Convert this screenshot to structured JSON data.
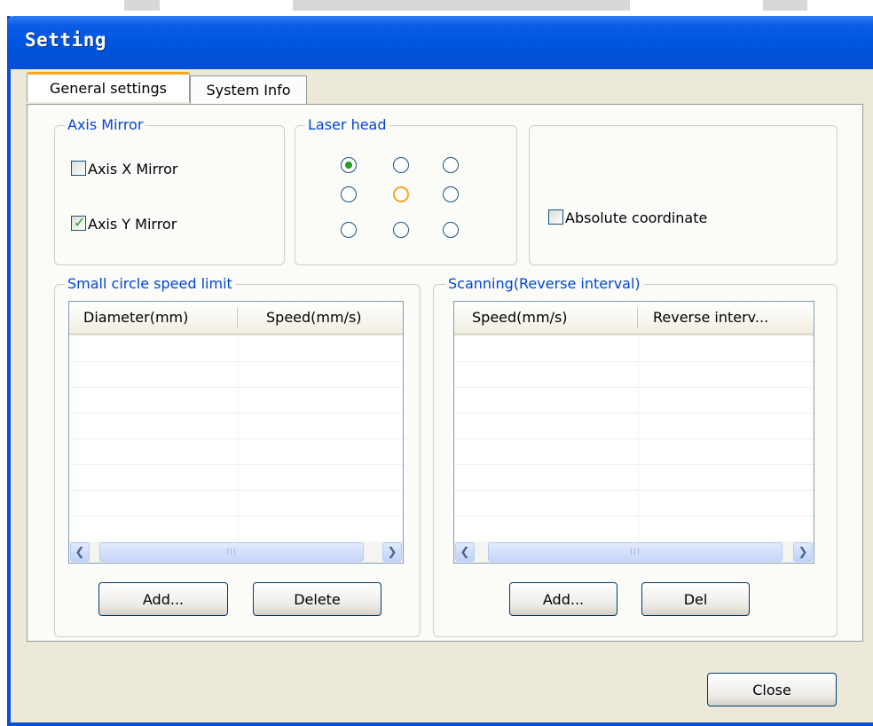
{
  "window": {
    "title": "Setting"
  },
  "tabs": [
    {
      "label": "General settings",
      "active": true
    },
    {
      "label": "System Info",
      "active": false
    }
  ],
  "axis_mirror": {
    "legend": "Axis Mirror",
    "x_mirror": {
      "label": "Axis X Mirror",
      "checked": false
    },
    "y_mirror": {
      "label": "Axis Y Mirror",
      "checked": true
    }
  },
  "laser_head": {
    "legend": "Laser head",
    "grid": [
      [
        "selected",
        "normal",
        "normal"
      ],
      [
        "normal",
        "hover",
        "normal"
      ],
      [
        "normal",
        "normal",
        "normal"
      ]
    ]
  },
  "coordinate": {
    "label": "Absolute coordinate",
    "checked": false
  },
  "small_circle": {
    "legend": "Small circle speed limit",
    "columns": [
      "Diameter(mm)",
      "Speed(mm/s)"
    ],
    "rows": [],
    "add_label": "Add...",
    "delete_label": "Delete"
  },
  "scanning": {
    "legend": "Scanning(Reverse interval)",
    "columns": [
      "Speed(mm/s)",
      "Reverse interv..."
    ],
    "rows": [],
    "add_label": "Add...",
    "delete_label": "Del"
  },
  "footer": {
    "close_label": "Close"
  },
  "colors": {
    "titlebar": "#0055e0",
    "legend_text": "#0046d5",
    "check": "#21a121",
    "active_tab": "#f5a623",
    "dialog_bg": "#ece9d8"
  },
  "scrollbar": {
    "thumb_grip": "III"
  }
}
